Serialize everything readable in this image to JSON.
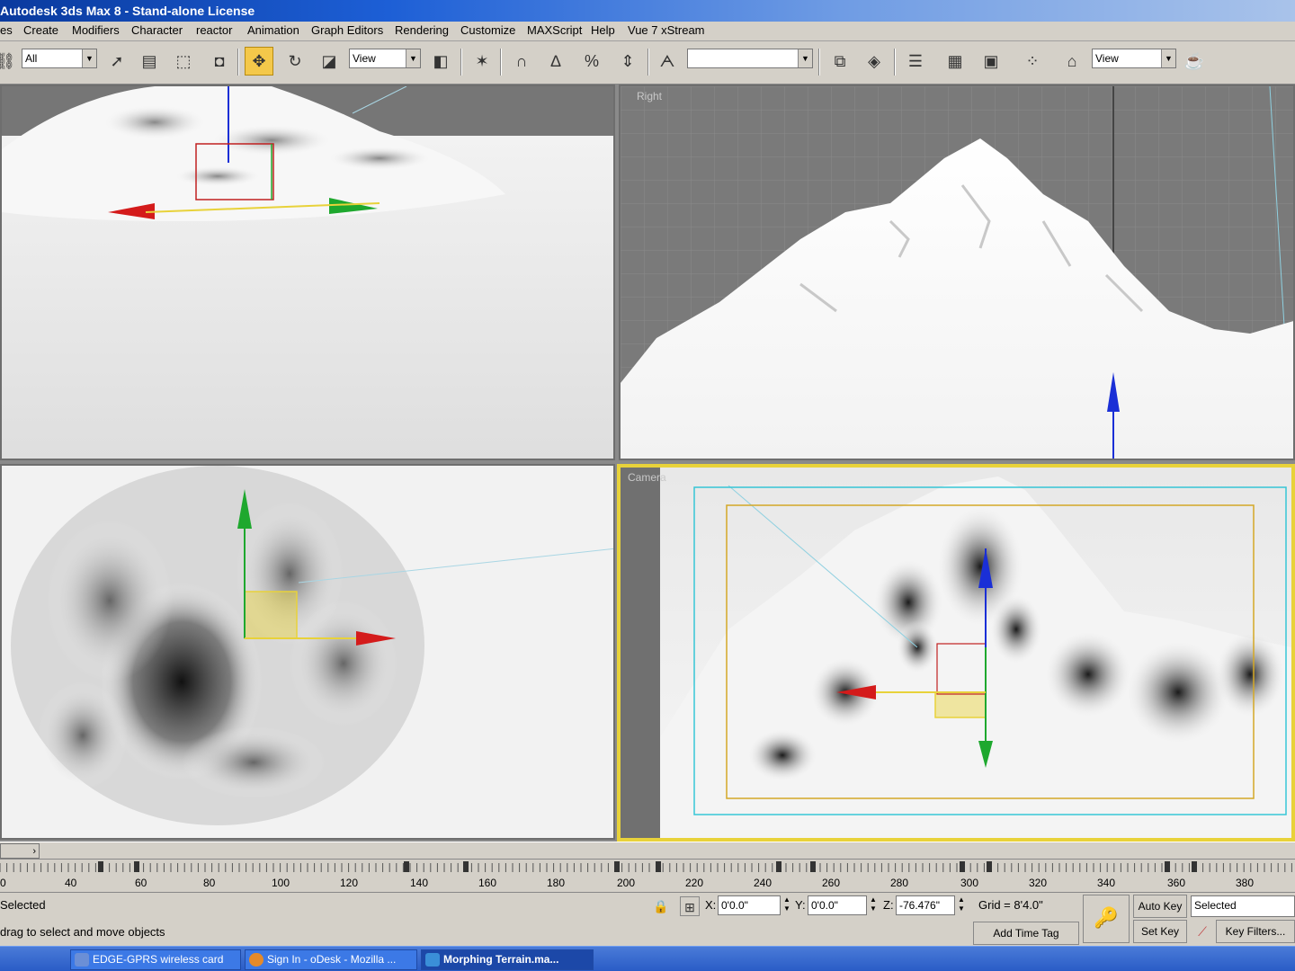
{
  "window": {
    "title": "Autodesk 3ds Max 8  - Stand-alone License"
  },
  "menu": {
    "items": [
      "es",
      "Create",
      "Modifiers",
      "Character",
      "reactor",
      "Animation",
      "Graph Editors",
      "Rendering",
      "Customize",
      "MAXScript",
      "Help",
      "Vue 7 xStream"
    ]
  },
  "toolbar": {
    "selection_filter": "All",
    "ref_coord_system": "View",
    "named_selection": "",
    "render_view": "View",
    "tools": [
      "undo-icon",
      "select-icon",
      "select-by-name-icon",
      "rect-region-icon",
      "window-crossing-icon",
      "select-move-icon",
      "select-rotate-icon",
      "select-scale-icon",
      "pivot-icon",
      "manipulate-icon",
      "snap-3d-icon",
      "angle-snap-icon",
      "percent-snap-icon",
      "spinner-snap-icon",
      "edit-named-sets-icon",
      "mirror-icon",
      "align-icon",
      "layer-manager-icon",
      "curve-editor-icon",
      "schematic-view-icon",
      "material-editor-icon",
      "render-scene-icon",
      "quick-render-icon"
    ]
  },
  "viewports": {
    "top_left": {
      "label": ""
    },
    "top_right": {
      "label": "Right"
    },
    "bottom_left": {
      "label": ""
    },
    "bottom_right": {
      "label": "Camera"
    }
  },
  "timeline": {
    "slider_text": "",
    "ruler_labels": [
      "0",
      "40",
      "60",
      "80",
      "100",
      "120",
      "140",
      "160",
      "180",
      "200",
      "220",
      "240",
      "260",
      "280",
      "300",
      "320",
      "340",
      "360",
      "380"
    ]
  },
  "status": {
    "selection": "Selected",
    "prompt": "drag to select and move objects",
    "x_label": "X:",
    "x_value": "0'0.0\"",
    "y_label": "Y:",
    "y_value": "0'0.0\"",
    "z_label": "Z:",
    "z_value": "-76.476\"",
    "grid": "Grid = 8'4.0\"",
    "add_time_tag": "Add Time Tag",
    "auto_key": "Auto Key",
    "set_key": "Set Key",
    "key_mode": "Selected",
    "key_filters": "Key Filters..."
  },
  "taskbar": {
    "tasks": [
      {
        "label": "EDGE-GPRS wireless card",
        "icon_color": "#6b8fd6"
      },
      {
        "label": "Sign In - oDesk - Mozilla ...",
        "icon_color": "#e58a2a"
      },
      {
        "label": "Morphing Terrain.ma...",
        "icon_color": "#3a8fd8"
      }
    ]
  },
  "colors": {
    "active_viewport_border": "#e8d23a",
    "gizmo_x": "#d41b1b",
    "gizmo_y": "#1ea82e",
    "gizmo_z": "#1a2fd6",
    "gizmo_plane": "#e8d23a"
  }
}
